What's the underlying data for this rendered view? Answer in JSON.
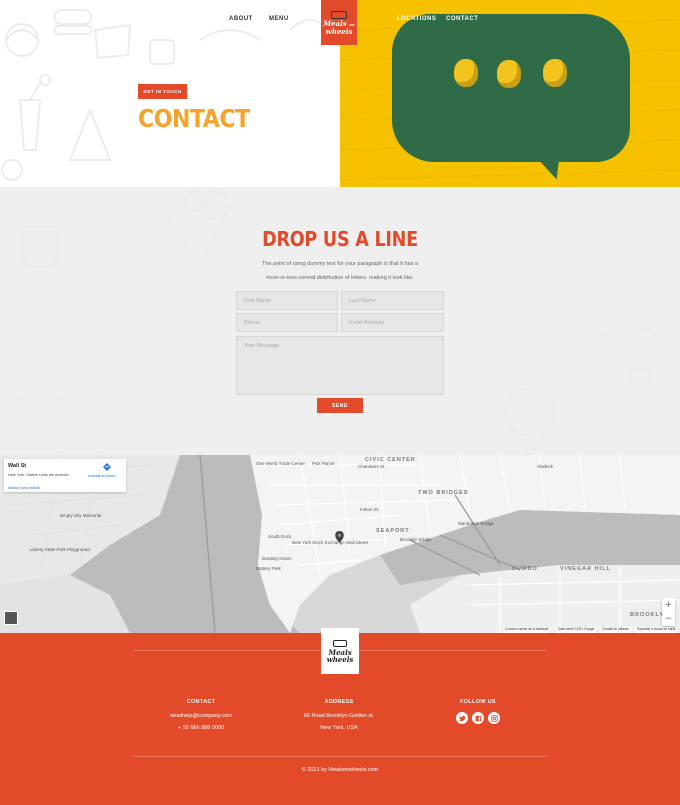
{
  "nav": {
    "about": "ABOUT",
    "menu": "MENU",
    "locations": "LOCATIONS",
    "contact": "CONTACT",
    "logo": [
      "Meals",
      "on",
      "wheels"
    ]
  },
  "hero": {
    "tag": "GET IN TOUCH",
    "title": "CONTACT"
  },
  "form": {
    "title": "DROP US A LINE",
    "desc_line1": "The point of using dummy text for your paragraph is that it has a",
    "desc_line2": "more-or-less normal distribution of letters. making it look like.",
    "first_name": "First Name",
    "last_name": "Last Name",
    "phone": "Phone",
    "email": "Email Address",
    "message": "Your Message",
    "send": "SEND"
  },
  "map": {
    "place_title": "Wall St",
    "place_address": "New York, Statele Unite ale Americii",
    "directions": "Indicații de orient...",
    "larger_map": "Afișați harta mărită",
    "labels": {
      "civic_center": "CIVIC CENTER",
      "two_bridges": "TWO BRIDGES",
      "seaport": "SEAPORT",
      "dumbo": "DUMBO",
      "vinegar_hill": "VINEGAR HILL",
      "brooklyn": "BROOKLYN",
      "wtc": "One World Trade Center",
      "pick_parcel": "Pick Parcel",
      "chambers": "Chambers St",
      "vladeck": "Vladeck",
      "nyse": "New York Stock Exchange",
      "wall_st_pin": "Wall Street",
      "bowling_green": "Bowling Green",
      "battery_park": "Battery Park",
      "south_dock": "South Dock",
      "brooklyn_bridge": "Brooklyn Bridge",
      "fulton": "Fulton St",
      "manhattan_bridge": "Manhattan Bridge",
      "empty_sky": "Empty Sky Memorial",
      "liberty_state": "Liberty State Park Playground"
    },
    "footer_keys": "Comenzi rapide de la tastatură",
    "footer_data": "Date hartă ©2021 Google",
    "footer_terms": "Condiții de utilizare",
    "footer_report": "Raportați o eroare pe hartă"
  },
  "footer": {
    "contact_title": "CONTACT",
    "email": "nesdhelp@company.com",
    "phone": "+ 92 666 888 0000",
    "address_title": "ADDRESS",
    "address_line1": "66 Road Brooklyn Golden st.",
    "address_line2": "New York, USA",
    "follow_title": "FOLLOW US",
    "copyright": "© 2021 by Mealsonwheels.com"
  },
  "colors": {
    "brand_red": "#e34a2a",
    "accent_orange": "#f5a32a",
    "hero_yellow": "#f6c200",
    "bubble_green": "#2f6b46"
  },
  "icons": [
    "twitter-icon",
    "facebook-icon",
    "instagram-icon",
    "directions-icon",
    "map-pin-icon",
    "zoom-in-icon",
    "zoom-out-icon"
  ]
}
